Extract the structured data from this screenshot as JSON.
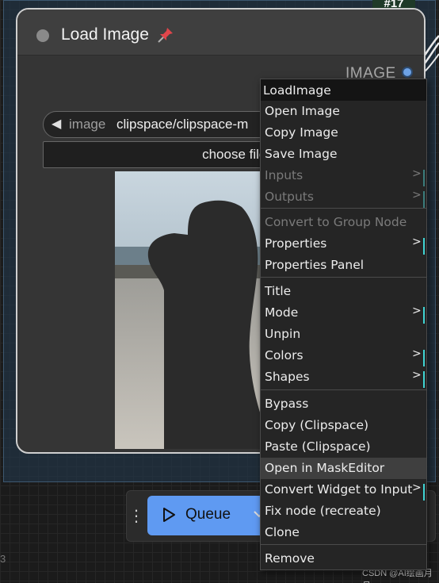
{
  "node": {
    "id_tag": "#17",
    "title": "Load Image",
    "output_label": "IMAGE",
    "image_widget": {
      "label": "image",
      "value": "clipspace/clipspace-m"
    },
    "upload_button_label": "choose file to up"
  },
  "context_menu": {
    "title": "LoadImage",
    "items": [
      {
        "label": "Open Image"
      },
      {
        "label": "Copy Image"
      },
      {
        "label": "Save Image"
      },
      {
        "label": "Inputs",
        "disabled": true,
        "submenu": true
      },
      {
        "label": "Outputs",
        "disabled": true,
        "submenu": true
      },
      {
        "label": "Convert to Group Node",
        "disabled": true
      },
      {
        "label": "Properties",
        "submenu": true
      },
      {
        "label": "Properties Panel"
      },
      {
        "label": "Title"
      },
      {
        "label": "Mode",
        "submenu": true
      },
      {
        "label": "Unpin"
      },
      {
        "label": "Colors",
        "submenu": true
      },
      {
        "label": "Shapes",
        "submenu": true
      },
      {
        "label": "Bypass"
      },
      {
        "label": "Copy (Clipspace)"
      },
      {
        "label": "Paste (Clipspace)"
      },
      {
        "label": "Open in MaskEditor",
        "highlighted": true
      },
      {
        "label": "Convert Widget to Input",
        "submenu": true
      },
      {
        "label": "Fix node (recreate)"
      },
      {
        "label": "Clone"
      },
      {
        "label": "Remove"
      }
    ],
    "submenu_arrow": ">"
  },
  "queue_bar": {
    "queue_label": "Queue",
    "drag_handle": "⋮"
  },
  "corner_text": "3",
  "watermark": "CSDN @AI绘画月月",
  "colors": {
    "queue_button": "#5f9af2",
    "output_slot": "#6ea3e6",
    "submenu_marker": "#3fd4d4",
    "node_border": "#cfcfcf"
  }
}
